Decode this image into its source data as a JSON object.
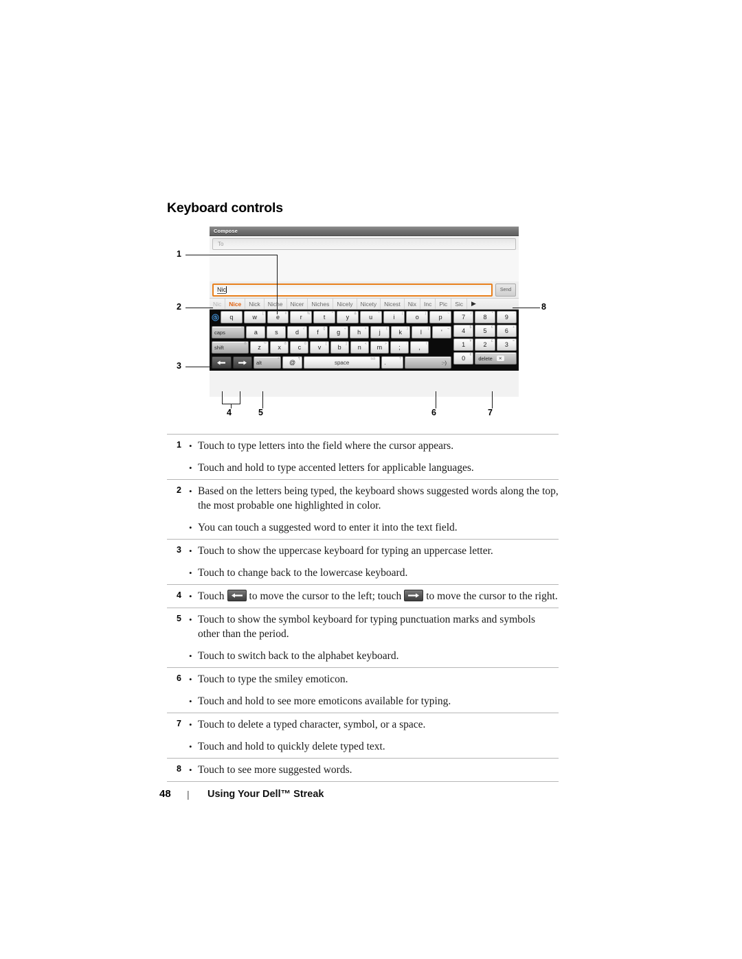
{
  "heading": "Keyboard controls",
  "device": {
    "title_bar": "Compose",
    "to_placeholder": "To",
    "typed_text": "Nic",
    "send_label": "Send",
    "suggestions": [
      {
        "label": "Nic",
        "state": "dim"
      },
      {
        "label": "Nice",
        "state": "highlight"
      },
      {
        "label": "Nick",
        "state": "normal"
      },
      {
        "label": "Niche",
        "state": "normal"
      },
      {
        "label": "Nicer",
        "state": "normal"
      },
      {
        "label": "Niches",
        "state": "normal"
      },
      {
        "label": "Nicely",
        "state": "normal"
      },
      {
        "label": "Nicety",
        "state": "normal"
      },
      {
        "label": "Nicest",
        "state": "normal"
      },
      {
        "label": "Nix",
        "state": "normal"
      },
      {
        "label": "Inc",
        "state": "normal"
      },
      {
        "label": "Pic",
        "state": "normal"
      },
      {
        "label": "Sic",
        "state": "normal"
      }
    ],
    "more_suggestions_glyph": "▶",
    "keyboard": {
      "row1": [
        {
          "key": "q",
          "alt": "`"
        },
        {
          "key": "w",
          "alt": "["
        },
        {
          "key": "e",
          "alt": "#"
        },
        {
          "key": "r",
          "alt": "%"
        },
        {
          "key": "t",
          "alt": "^"
        },
        {
          "key": "y",
          "alt": "&"
        },
        {
          "key": "u",
          "alt": "*"
        },
        {
          "key": "i",
          "alt": "("
        },
        {
          "key": "o",
          "alt": ")"
        },
        {
          "key": "p",
          "alt": "~"
        }
      ],
      "row2_mod": {
        "key": "caps",
        "alt": "°"
      },
      "row2": [
        {
          "key": "a",
          "alt": "¯"
        },
        {
          "key": "s",
          "alt": "·"
        },
        {
          "key": "d",
          "alt": "√"
        },
        {
          "key": "f",
          "alt": "{}"
        },
        {
          "key": "g",
          "alt": "÷"
        },
        {
          "key": "h",
          "alt": "×"
        },
        {
          "key": "j",
          "alt": "{"
        },
        {
          "key": "k",
          "alt": "}"
        },
        {
          "key": "l",
          "alt": "|"
        },
        {
          "key": "'",
          "alt": "¬"
        }
      ],
      "row3_mod": {
        "key": "shift",
        "alt": "®"
      },
      "row3": [
        {
          "key": "z",
          "alt": "™"
        },
        {
          "key": "x",
          "alt": "®"
        },
        {
          "key": "c",
          "alt": "©"
        },
        {
          "key": "v",
          "alt": "["
        },
        {
          "key": "b",
          "alt": "]"
        },
        {
          "key": "n",
          "alt": "<"
        },
        {
          "key": "m",
          "alt": ">"
        },
        {
          "key": ";",
          "alt": ":"
        },
        {
          "key": ",",
          "alt": "\\"
        }
      ],
      "row4": [
        {
          "key": "arrow-left",
          "alt": ""
        },
        {
          "key": "arrow-right",
          "alt": ""
        },
        {
          "key": "alt",
          "alt": "ª"
        },
        {
          "key": "@",
          "alt": "¶"
        },
        {
          "key": "space",
          "alt": "tab"
        },
        {
          "key": ".",
          "alt": "?"
        },
        {
          "key": ":-)",
          "alt": ""
        }
      ],
      "numpad": {
        "row1": [
          {
            "key": "7",
            "alt": "/"
          },
          {
            "key": "8",
            "alt": "*"
          },
          {
            "key": "9",
            "alt": "·"
          }
        ],
        "row2": [
          {
            "key": "4",
            "alt": "$"
          },
          {
            "key": "5",
            "alt": "€"
          },
          {
            "key": "6",
            "alt": "+"
          }
        ],
        "row3": [
          {
            "key": "1",
            "alt": "¥"
          },
          {
            "key": "2",
            "alt": "£"
          },
          {
            "key": "3",
            "alt": "="
          }
        ],
        "row4_zero": {
          "key": "0",
          "alt": "¢"
        },
        "delete_label": "delete"
      }
    }
  },
  "callouts": {
    "n1": "1",
    "n2": "2",
    "n3": "3",
    "n4": "4",
    "n5": "5",
    "n6": "6",
    "n7": "7",
    "n8": "8"
  },
  "description_rows": [
    {
      "num": "1",
      "items": [
        "Touch to type letters into the field where the cursor appears.",
        "Touch and hold to type accented letters for applicable languages."
      ]
    },
    {
      "num": "2",
      "items": [
        "Based on the letters being typed, the keyboard shows suggested words along the top, the most probable one highlighted in color.",
        "You can touch a suggested word to enter it into the text field."
      ]
    },
    {
      "num": "3",
      "items": [
        "Touch to show the uppercase keyboard for typing an uppercase letter.",
        "Touch to change back to the lowercase keyboard."
      ]
    },
    {
      "num": "4",
      "items": [],
      "special": {
        "pre": "Touch",
        "mid": "to move the cursor to the left; touch",
        "post": "to move the cursor to the right."
      }
    },
    {
      "num": "5",
      "items": [
        "Touch to show the symbol keyboard for typing punctuation marks and symbols other than the period.",
        "Touch to switch back to the alphabet keyboard."
      ]
    },
    {
      "num": "6",
      "items": [
        "Touch to type the smiley emoticon.",
        "Touch and hold to see more emoticons available for typing."
      ]
    },
    {
      "num": "7",
      "items": [
        "Touch to delete a typed character, symbol, or a space.",
        "Touch and hold to quickly delete typed text."
      ]
    },
    {
      "num": "8",
      "items": [
        "Touch to see more suggested words."
      ]
    }
  ],
  "footer": {
    "page_number": "48",
    "separator": "|",
    "title": "Using Your Dell™ Streak"
  }
}
